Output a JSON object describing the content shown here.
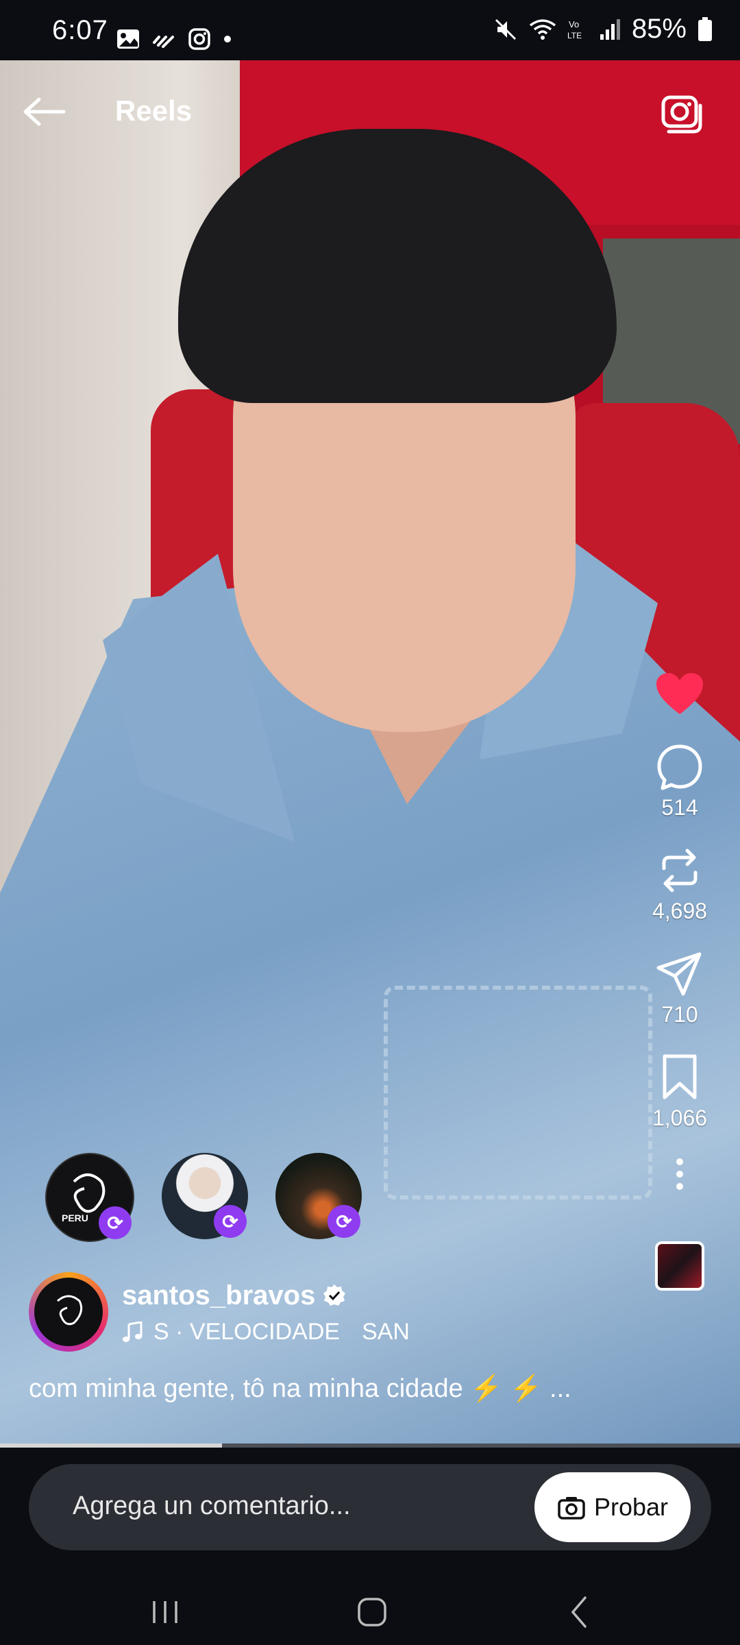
{
  "status": {
    "time": "6:07",
    "battery": "85%",
    "left_icons": [
      "gallery-icon",
      "signal-scribble-icon",
      "instagram-icon",
      "dot-icon"
    ],
    "right_icons": [
      "mute-icon",
      "wifi-icon",
      "volte-icon",
      "signal-icon",
      "battery-icon"
    ]
  },
  "header": {
    "title": "Reels"
  },
  "actions": {
    "comments": "514",
    "reposts": "4,698",
    "shares": "710",
    "saves": "1,066"
  },
  "reposters": [
    "santos_bravos",
    "user-2",
    "user-3"
  ],
  "author": {
    "username": "santos_bravos",
    "music": "S · VELOCIDADE",
    "music_extra": "SAN"
  },
  "caption": "com minha gente, tô na minha cidade ⚡ ⚡ ...",
  "progress_fraction": 0.3,
  "comment": {
    "placeholder": "Agrega un comentario...",
    "try_label": "Probar"
  },
  "colors": {
    "like": "#ff2d55",
    "repost_badge": "#8f3cf1",
    "background": "#0b0d12"
  }
}
